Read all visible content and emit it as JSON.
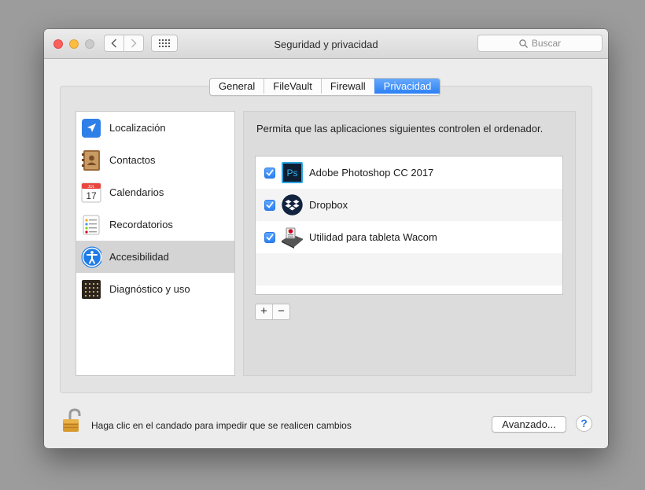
{
  "window": {
    "title": "Seguridad y privacidad",
    "search_placeholder": "Buscar"
  },
  "tabs": [
    {
      "label": "General",
      "active": false
    },
    {
      "label": "FileVault",
      "active": false
    },
    {
      "label": "Firewall",
      "active": false
    },
    {
      "label": "Privacidad",
      "active": true
    }
  ],
  "sidebar": {
    "items": [
      {
        "label": "Localización",
        "icon": "location-arrow-icon"
      },
      {
        "label": "Contactos",
        "icon": "contacts-book-icon"
      },
      {
        "label": "Calendarios",
        "icon": "calendar-icon",
        "icon_month": "JUL",
        "icon_day": "17"
      },
      {
        "label": "Recordatorios",
        "icon": "reminders-icon"
      },
      {
        "label": "Accesibilidad",
        "icon": "accessibility-icon",
        "selected": true
      },
      {
        "label": "Diagnóstico y uso",
        "icon": "diagnostics-icon"
      }
    ]
  },
  "panel": {
    "description": "Permita que las aplicaciones siguientes controlen el ordenador.",
    "apps": [
      {
        "name": "Adobe Photoshop CC 2017",
        "checked": true,
        "icon": "photoshop-icon",
        "icon_text": "Ps"
      },
      {
        "name": "Dropbox",
        "checked": true,
        "icon": "dropbox-icon"
      },
      {
        "name": "Utilidad para tableta Wacom",
        "checked": true,
        "icon": "wacom-utility-icon"
      }
    ],
    "add_label": "+",
    "remove_label": "−"
  },
  "footer": {
    "lock_text": "Haga clic en el candado para impedir que se realicen cambios",
    "advanced_label": "Avanzado...",
    "help_label": "?"
  },
  "colors": {
    "accent": "#2c81f5",
    "selection": "#d4d4d4"
  }
}
